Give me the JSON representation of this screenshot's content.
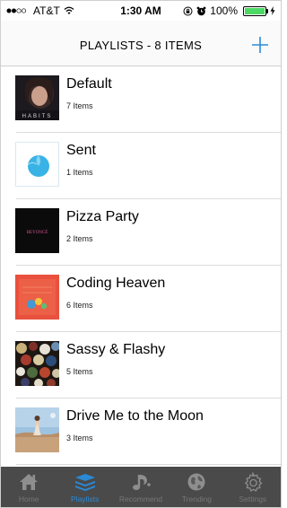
{
  "status": {
    "carrier": "AT&T",
    "time": "1:30 AM",
    "battery": "100%",
    "battery_level": 1.0
  },
  "nav": {
    "title": "PLAYLISTS - 8 ITEMS"
  },
  "playlists": [
    {
      "title": "Default",
      "count": "7 Items"
    },
    {
      "title": "Sent",
      "count": "1 Items"
    },
    {
      "title": "Pizza Party",
      "count": "2 Items"
    },
    {
      "title": "Coding Heaven",
      "count": "6 Items"
    },
    {
      "title": "Sassy & Flashy",
      "count": "5 Items"
    },
    {
      "title": "Drive Me to the Moon",
      "count": "3 Items"
    }
  ],
  "thumbs": {
    "default": {
      "text": "HABITS"
    },
    "pizza": {
      "text": "BEYONCÉ"
    }
  },
  "tabs": [
    {
      "label": "Home",
      "icon": "home-icon"
    },
    {
      "label": "Playlists",
      "icon": "stack-icon"
    },
    {
      "label": "Recommend",
      "icon": "music-note-icon"
    },
    {
      "label": "Trending",
      "icon": "globe-icon"
    },
    {
      "label": "Settings",
      "icon": "gear-icon"
    }
  ],
  "colors": {
    "accent": "#2a8ad8",
    "tabbar_bg": "#4a4a4a",
    "battery_green": "#4cd964"
  }
}
